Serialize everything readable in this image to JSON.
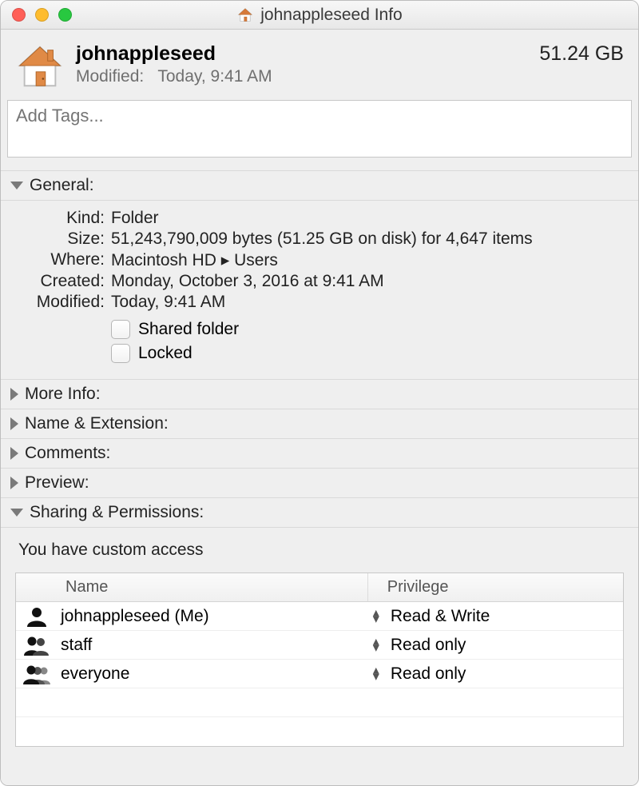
{
  "window": {
    "title": "johnappleseed Info"
  },
  "header": {
    "name": "johnappleseed",
    "modified_label": "Modified:",
    "modified_value": "Today, 9:41 AM",
    "size": "51.24 GB"
  },
  "tags": {
    "placeholder": "Add Tags..."
  },
  "sections": {
    "general_label": "General:",
    "more_info_label": "More Info:",
    "name_ext_label": "Name & Extension:",
    "comments_label": "Comments:",
    "preview_label": "Preview:",
    "sharing_label": "Sharing & Permissions:"
  },
  "general": {
    "kind_label": "Kind:",
    "kind_value": "Folder",
    "size_label": "Size:",
    "size_value": "51,243,790,009 bytes (51.25 GB on disk) for 4,647 items",
    "where_label": "Where:",
    "where_value": "Macintosh HD ▸ Users",
    "created_label": "Created:",
    "created_value": "Monday, October 3, 2016 at 9:41 AM",
    "modified_label": "Modified:",
    "modified_value": "Today, 9:41 AM",
    "shared_folder_label": "Shared folder",
    "locked_label": "Locked"
  },
  "sharing": {
    "access_note": "You have custom access",
    "col_name": "Name",
    "col_priv": "Privilege",
    "rows": [
      {
        "name": "johnappleseed (Me)",
        "priv": "Read & Write",
        "icon": "user"
      },
      {
        "name": "staff",
        "priv": "Read only",
        "icon": "group2"
      },
      {
        "name": "everyone",
        "priv": "Read only",
        "icon": "group3"
      }
    ]
  }
}
